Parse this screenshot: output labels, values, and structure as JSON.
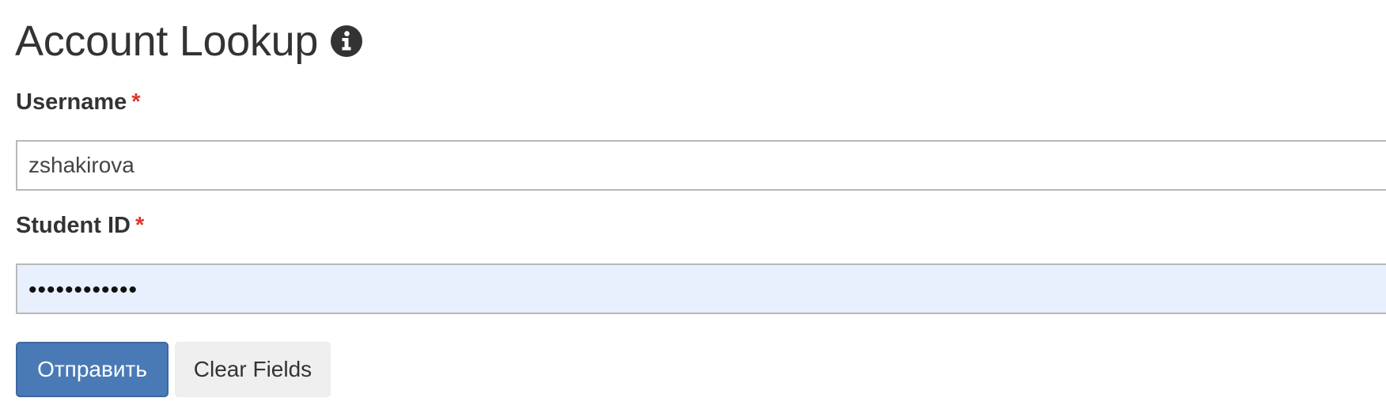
{
  "header": {
    "title": "Account Lookup",
    "info_icon": "info-circle-icon"
  },
  "form": {
    "username": {
      "label": "Username",
      "required_mark": "*",
      "value": "zshakirova"
    },
    "student_id": {
      "label": "Student ID",
      "required_mark": "*",
      "masked_value": "••••••••••••",
      "autofilled": true
    },
    "buttons": {
      "submit_label": "Отправить",
      "clear_label": "Clear Fields"
    }
  },
  "colors": {
    "primary_button": "#4a7ab6",
    "required": "#e0352b",
    "autofill_background": "#e8f0fe"
  }
}
